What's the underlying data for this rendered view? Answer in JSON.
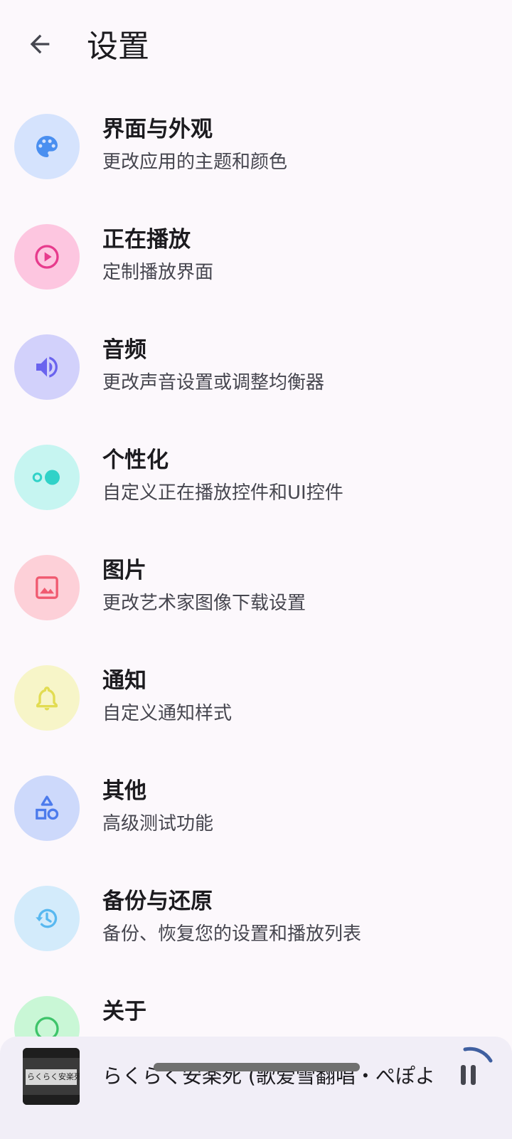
{
  "header": {
    "title": "设置",
    "back_icon": "arrow-back-icon"
  },
  "settings": [
    {
      "id": "appearance",
      "title": "界面与外观",
      "subtitle": "更改应用的主题和颜色",
      "icon": "palette-icon",
      "bg": "#d5e3fd",
      "fg": "#4a8ff0"
    },
    {
      "id": "now-playing",
      "title": "正在播放",
      "subtitle": "定制播放界面",
      "icon": "play-circle-icon",
      "bg": "#fdc6e0",
      "fg": "#e73b8d"
    },
    {
      "id": "audio",
      "title": "音频",
      "subtitle": "更改声音设置或调整均衡器",
      "icon": "volume-icon",
      "bg": "#d2d1fb",
      "fg": "#6a63ee"
    },
    {
      "id": "personalize",
      "title": "个性化",
      "subtitle": "自定义正在播放控件和UI控件",
      "icon": "toggle-dots-icon",
      "bg": "#c6f5f1",
      "fg": "#30d2c8"
    },
    {
      "id": "images",
      "title": "图片",
      "subtitle": "更改艺术家图像下载设置",
      "icon": "image-icon",
      "bg": "#fdd0d8",
      "fg": "#f05a70"
    },
    {
      "id": "notification",
      "title": "通知",
      "subtitle": "自定义通知样式",
      "icon": "bell-icon",
      "bg": "#f7f5c8",
      "fg": "#e2dc52"
    },
    {
      "id": "other",
      "title": "其他",
      "subtitle": "高级测试功能",
      "icon": "shapes-icon",
      "bg": "#cdd9fb",
      "fg": "#4c7bec"
    },
    {
      "id": "backup",
      "title": "备份与还原",
      "subtitle": "备份、恢复您的设置和播放列表",
      "icon": "history-icon",
      "bg": "#d3ebfb",
      "fg": "#58b8f0"
    },
    {
      "id": "about",
      "title": "关于",
      "subtitle": "",
      "icon": "info-icon",
      "bg": "#c9f7d6",
      "fg": "#3ec46a"
    }
  ],
  "mini_player": {
    "song": "らくらく安楽死 (歌爱雪翻唱・ぺぽよ",
    "album_art_text": "らくらく安楽死",
    "pause_icon": "pause-icon"
  }
}
